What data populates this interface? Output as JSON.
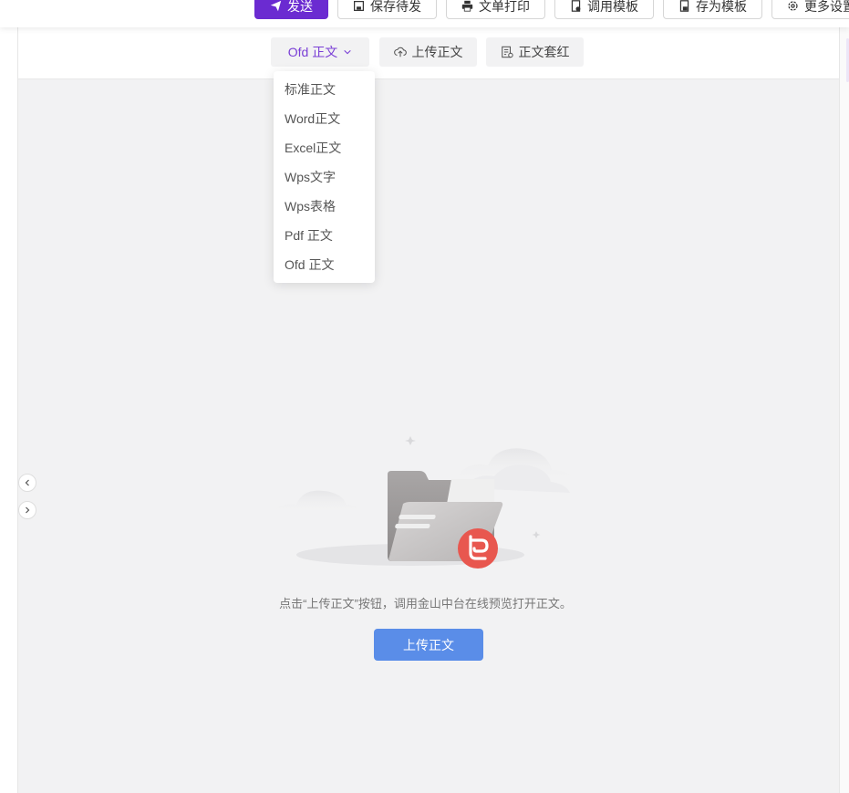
{
  "topbar": {
    "send_label": "发送",
    "save_draft_label": "保存待发",
    "print_label": "文单打印",
    "use_template_label": "调用模板",
    "save_template_label": "存为模板",
    "more_settings_label": "更多设置"
  },
  "doc_toolbar": {
    "format_select_label": "Ofd 正文",
    "upload_label": "上传正文",
    "redhead_label": "正文套红"
  },
  "format_menu": {
    "items": [
      "标准正文",
      "Word正文",
      "Excel正文",
      "Wps文字",
      "Wps表格",
      "Pdf 正文",
      "Ofd 正文"
    ]
  },
  "empty_state": {
    "message": "点击“上传正文”按钮，调用金山中台在线预览打开正文。",
    "upload_button_label": "上传正文"
  },
  "colors": {
    "primary": "#6b2bd1",
    "upload_blue": "#5a8de8",
    "badge_red": "#e8574f"
  },
  "icons": [
    "send-icon",
    "save-icon",
    "print-icon",
    "template-icon",
    "save-template-icon",
    "gear-icon",
    "chevron-down-icon",
    "cloud-upload-icon",
    "document-icon",
    "chevron-left-icon",
    "chevron-right-icon",
    "folder-icon",
    "wps-badge-icon"
  ]
}
